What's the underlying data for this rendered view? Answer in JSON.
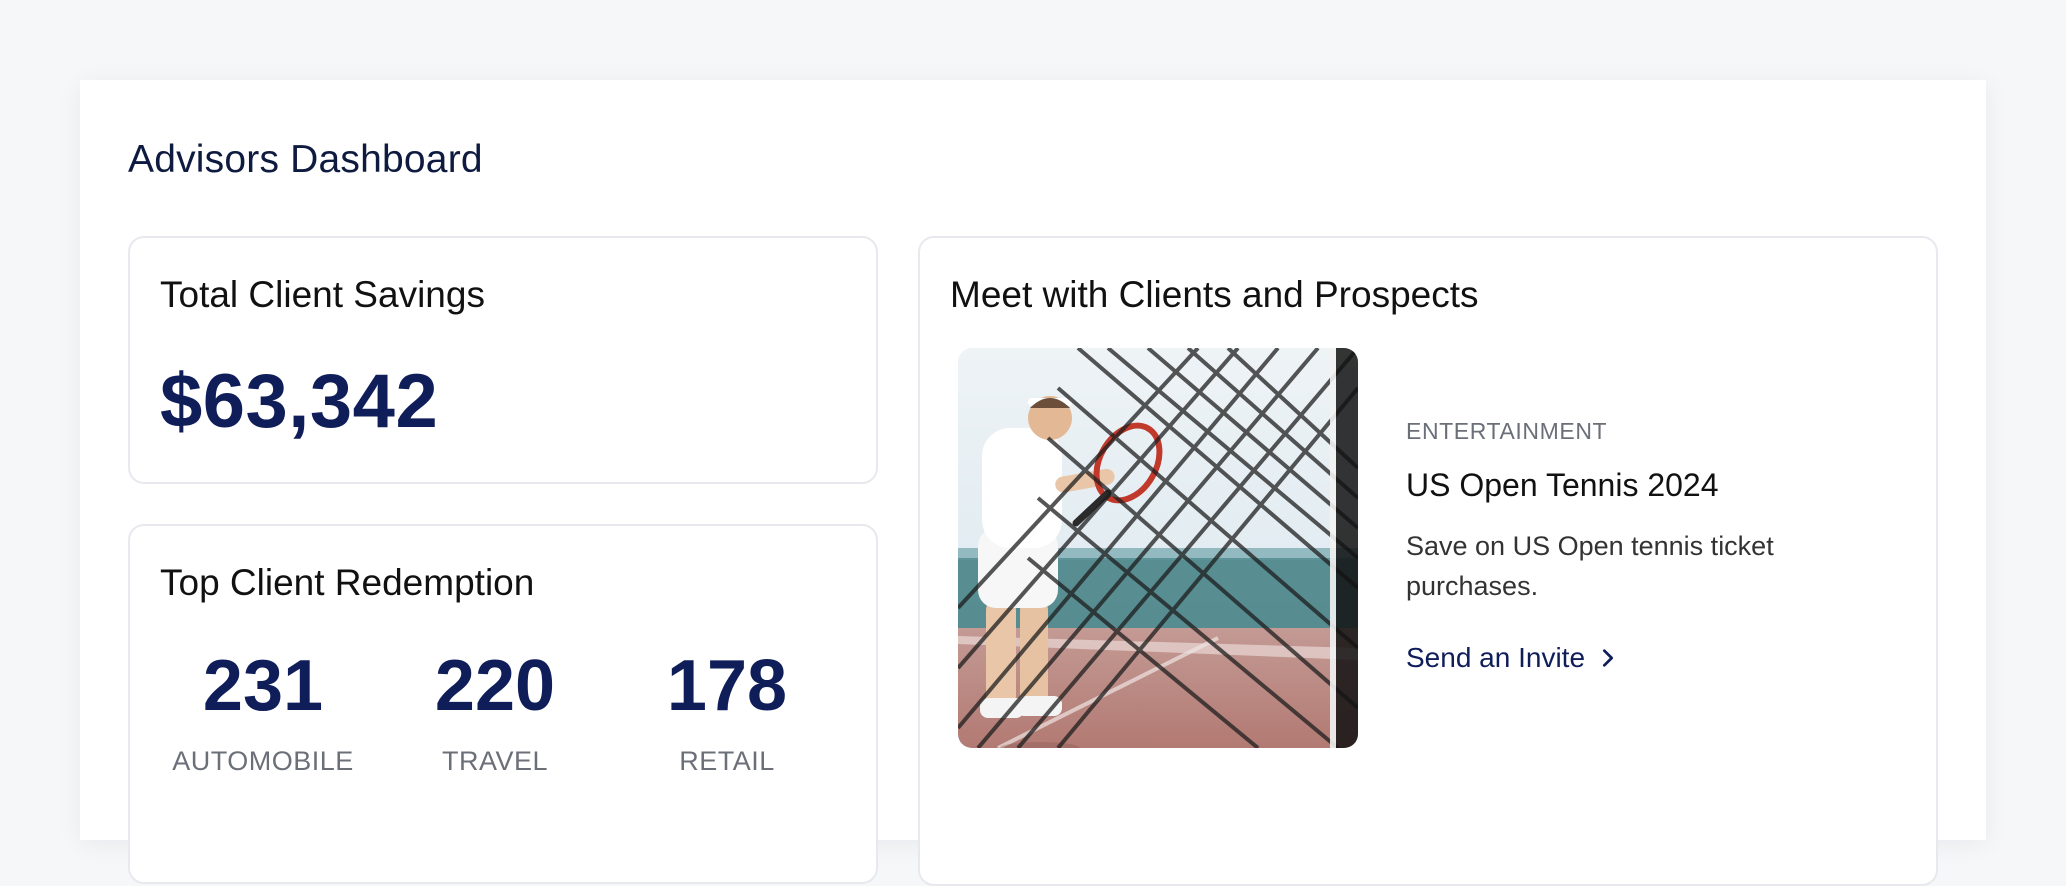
{
  "page": {
    "title": "Advisors Dashboard"
  },
  "savings_card": {
    "title": "Total Client Savings",
    "amount": "$63,342"
  },
  "redemption_card": {
    "title": "Top Client Redemption",
    "stats": [
      {
        "value": "231",
        "label": "AUTOMOBILE"
      },
      {
        "value": "220",
        "label": "TRAVEL"
      },
      {
        "value": "178",
        "label": "RETAIL"
      }
    ]
  },
  "meet_card": {
    "title": "Meet with Clients and Prospects",
    "event": {
      "image_icon": "tennis-player-photo",
      "category": "ENTERTAINMENT",
      "title": "US Open Tennis 2024",
      "description": "Save on US Open tennis ticket purchases.",
      "link_label": "Send an Invite",
      "link_icon": "chevron-right-icon"
    }
  },
  "colors": {
    "background": "#f6f7f9",
    "panel": "#ffffff",
    "accent_navy": "#0f1d59",
    "muted_text": "#6b6f78",
    "card_border": "#e7e9ee"
  }
}
